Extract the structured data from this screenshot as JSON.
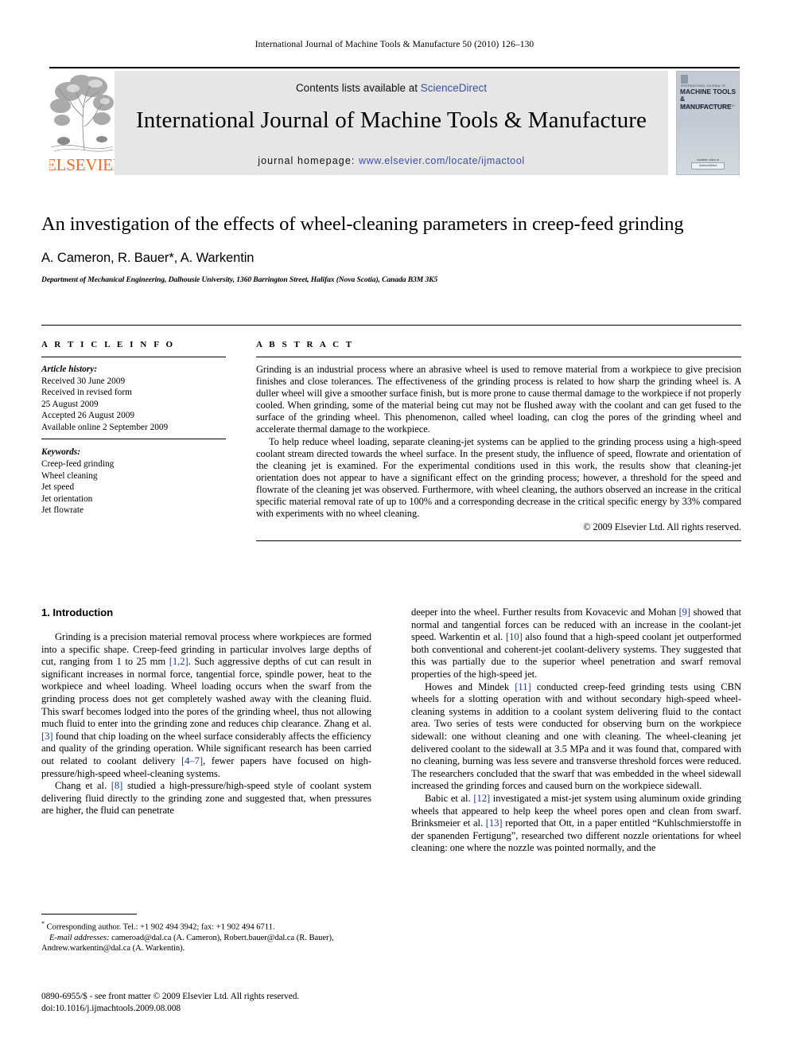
{
  "running_head": "International Journal of Machine Tools & Manufacture 50 (2010) 126–130",
  "masthead": {
    "publisher_name": "ELSEVIER",
    "contents_prefix": "Contents lists available at ",
    "contents_link": "ScienceDirect",
    "journal_title": "International Journal of Machine Tools & Manufacture",
    "homepage_prefix": "journal homepage: ",
    "homepage_url": "www.elsevier.com/locate/ijmactool",
    "cover": {
      "eyebrow": "INTERNATIONAL JOURNAL OF",
      "name": "MACHINE TOOLS & MANUFACTURE",
      "subtitle": "DESIGN, RESEARCH AND APPLICATION",
      "bottom_label": "Available online at",
      "badge": "ScienceDirect"
    }
  },
  "article": {
    "title": "An investigation of the effects of wheel-cleaning parameters in creep-feed grinding",
    "authors": "A. Cameron, R. Bauer*, A. Warkentin",
    "affiliation": "Department of Mechanical Engineering, Dalhousie University, 1360 Barrington Street, Halifax (Nova Scotia), Canada B3M 3K5"
  },
  "article_info": {
    "heading": "A R T I C L E  I N F O",
    "history_label": "Article history:",
    "history_lines": [
      "Received 30 June 2009",
      "Received in revised form",
      "25 August 2009",
      "Accepted 26 August 2009",
      "Available online 2 September 2009"
    ],
    "keywords_label": "Keywords:",
    "keywords": [
      "Creep-feed grinding",
      "Wheel cleaning",
      "Jet speed",
      "Jet orientation",
      "Jet flowrate"
    ]
  },
  "abstract": {
    "heading": "A B S T R A C T",
    "paragraphs": [
      "Grinding is an industrial process where an abrasive wheel is used to remove material from a workpiece to give precision finishes and close tolerances. The effectiveness of the grinding process is related to how sharp the grinding wheel is. A duller wheel will give a smoother surface finish, but is more prone to cause thermal damage to the workpiece if not properly cooled. When grinding, some of the material being cut may not be flushed away with the coolant and can get fused to the surface of the grinding wheel. This phenomenon, called wheel loading, can clog the pores of the grinding wheel and accelerate thermal damage to the workpiece.",
      "To help reduce wheel loading, separate cleaning-jet systems can be applied to the grinding process using a high-speed coolant stream directed towards the wheel surface. In the present study, the influence of speed, flowrate and orientation of the cleaning jet is examined. For the experimental conditions used in this work, the results show that cleaning-jet orientation does not appear to have a significant effect on the grinding process; however, a threshold for the speed and flowrate of the cleaning jet was observed. Furthermore, with wheel cleaning, the authors observed an increase in the critical specific material removal rate of up to 100% and a corresponding decrease in the critical specific energy by 33% compared with experiments with no wheel cleaning."
    ],
    "copyright": "© 2009 Elsevier Ltd. All rights reserved."
  },
  "body": {
    "section_title": "1. Introduction",
    "left_paragraphs": [
      "Grinding is a precision material removal process where workpieces are formed into a specific shape. Creep-feed grinding in particular involves large depths of cut, ranging from 1 to 25 mm [1,2]. Such aggressive depths of cut can result in significant increases in normal force, tangential force, spindle power, heat to the workpiece and wheel loading. Wheel loading occurs when the swarf from the grinding process does not get completely washed away with the cleaning fluid. This swarf becomes lodged into the pores of the grinding wheel, thus not allowing much fluid to enter into the grinding zone and reduces chip clearance. Zhang et al. [3] found that chip loading on the wheel surface considerably affects the efficiency and quality of the grinding operation. While significant research has been carried out related to coolant delivery [4–7], fewer papers have focused on high-pressure/high-speed wheel-cleaning systems.",
      "Chang et al. [8] studied a high-pressure/high-speed style of coolant system delivering fluid directly to the grinding zone and suggested that, when pressures are higher, the fluid can penetrate"
    ],
    "right_paragraphs": [
      "deeper into the wheel. Further results from Kovacevic and Mohan [9] showed that normal and tangential forces can be reduced with an increase in the coolant-jet speed. Warkentin et al. [10] also found that a high-speed coolant jet outperformed both conventional and coherent-jet coolant-delivery systems. They suggested that this was partially due to the superior wheel penetration and swarf removal properties of the high-speed jet.",
      "Howes and Mindek [11] conducted creep-feed grinding tests using CBN wheels for a slotting operation with and without secondary high-speed wheel-cleaning systems in addition to a coolant system delivering fluid to the contact area. Two series of tests were conducted for observing burn on the workpiece sidewall: one without cleaning and one with cleaning. The wheel-cleaning jet delivered coolant to the sidewall at 3.5 MPa and it was found that, compared with no cleaning, burning was less severe and transverse threshold forces were reduced. The researchers concluded that the swarf that was embedded in the wheel sidewall increased the grinding forces and caused burn on the workpiece sidewall.",
      "Babic et al. [12] investigated a mist-jet system using aluminum oxide grinding wheels that appeared to help keep the wheel pores open and clean from swarf. Brinksmeier et al. [13] reported that Ott, in a paper entitled “Kuhlschmierstoffe in der spanenden Fertigung”, researched two different nozzle orientations for wheel cleaning: one where the nozzle was pointed normally, and the"
    ]
  },
  "footnotes": {
    "corresponding": "Corresponding author. Tel.: +1 902 494 3942; fax: +1 902 494 6711.",
    "email_label": "E-mail addresses:",
    "emails": "cameroad@dal.ca (A. Cameron), Robert.bauer@dal.ca (R. Bauer), Andrew.warkentin@dal.ca (A. Warkentin).",
    "issn_line": "0890-6955/$ - see front matter © 2009 Elsevier Ltd. All rights reserved.",
    "doi_line": "doi:10.1016/j.ijmachtools.2009.08.008"
  },
  "colors": {
    "link": "#3b4fa0",
    "reference": "#1b3a8c",
    "elsevier_orange": "#F26B21",
    "masthead_bg": "#e6e6e6"
  }
}
